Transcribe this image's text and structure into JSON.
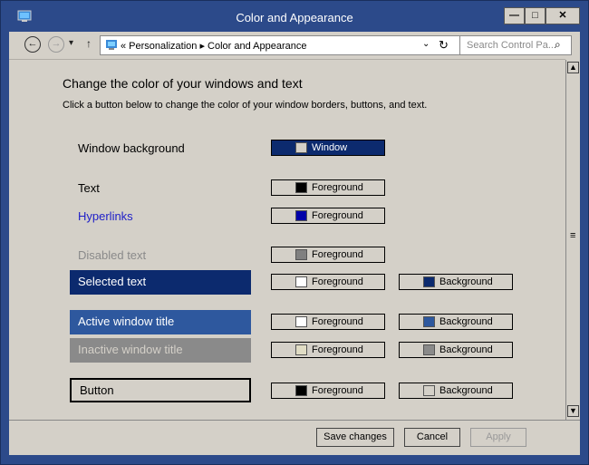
{
  "window": {
    "title": "Color and Appearance",
    "min_glyph": "—",
    "max_glyph": "□",
    "close_glyph": "✕"
  },
  "nav": {
    "back_glyph": "←",
    "forward_glyph": "→",
    "recent_glyph": "▾",
    "up_glyph": "↑",
    "breadcrumb": "«  Personalization  ▸  Color and Appearance",
    "dropdown_glyph": "⌄",
    "refresh_glyph": "↻",
    "search_placeholder": "Search Control Pa...",
    "search_glyph": "⌕"
  },
  "main": {
    "heading": "Change the color of your windows and text",
    "description": "Click a button below to change the color of your window borders, buttons, and text.",
    "rows": {
      "window_background": {
        "label": "Window background",
        "btn1": {
          "label": "Window",
          "color": "#d4d0c8"
        }
      },
      "text": {
        "label": "Text",
        "btn1": {
          "label": "Foreground",
          "color": "#000000"
        }
      },
      "hyperlinks": {
        "label": "Hyperlinks",
        "color": "#1e1ec8",
        "btn1": {
          "label": "Foreground",
          "color": "#0000a8"
        }
      },
      "disabled_text": {
        "label": "Disabled text",
        "color": "#8a8a8a",
        "btn1": {
          "label": "Foreground",
          "color": "#808080"
        }
      },
      "selected_text": {
        "label": "Selected text",
        "bg": "#0c2a6e",
        "btn1": {
          "label": "Foreground",
          "color": "#ffffff"
        },
        "btn2": {
          "label": "Background",
          "color": "#0c2a6e"
        }
      },
      "active_title": {
        "label": "Active window title",
        "bg": "#2e589e",
        "btn1": {
          "label": "Foreground",
          "color": "#ffffff"
        },
        "btn2": {
          "label": "Background",
          "color": "#2e589e"
        }
      },
      "inactive_title": {
        "label": "Inactive window title",
        "bg": "#8a8a8a",
        "fg": "#d4d0c8",
        "btn1": {
          "label": "Foreground",
          "color": "#e0dcc4"
        },
        "btn2": {
          "label": "Background",
          "color": "#8a8a8a"
        }
      },
      "button": {
        "label": "Button",
        "btn1": {
          "label": "Foreground",
          "color": "#000000"
        },
        "btn2": {
          "label": "Background",
          "color": "#d4d0c8"
        }
      }
    }
  },
  "scrollbar": {
    "up_glyph": "▲",
    "down_glyph": "▼",
    "thumb_glyph": "≡"
  },
  "footer": {
    "save_label": "Save changes",
    "cancel_label": "Cancel",
    "apply_label": "Apply"
  },
  "colors": {
    "window_frame": "#2c4a8a",
    "surface": "#d4d0c8",
    "window_button_fill": "#0c2a6e"
  }
}
